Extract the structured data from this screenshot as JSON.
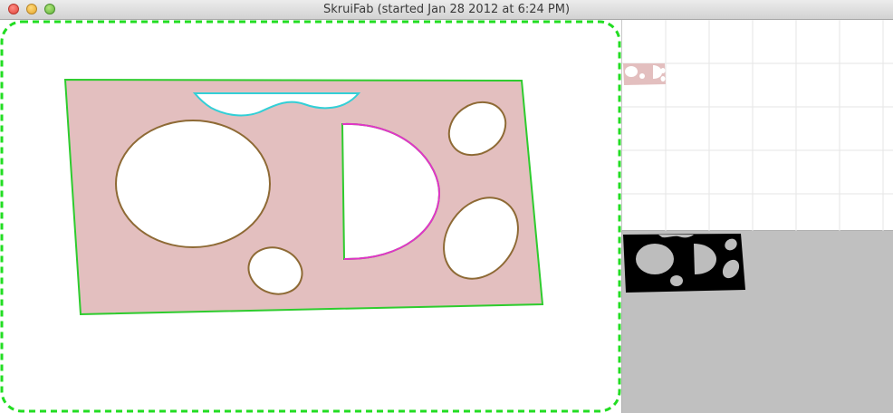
{
  "window": {
    "title": "SkruiFab (started Jan 28 2012 at 6:24 PM)"
  },
  "colors": {
    "selection_dash": "#22dd22",
    "part_fill": "#e3bfbf",
    "outline_green": "#2ecc2e",
    "hole_brown": "#8e6a35",
    "hole_cyan": "#33cfd6",
    "hole_magenta": "#e234c8",
    "mask_bg": "#c0c0c0",
    "mask_fill": "#000000",
    "mask_holes": "#bdbdbd"
  },
  "icons": {
    "close": "close-button-icon",
    "minimize": "minimize-button-icon",
    "maximize": "zoom-button-icon"
  }
}
